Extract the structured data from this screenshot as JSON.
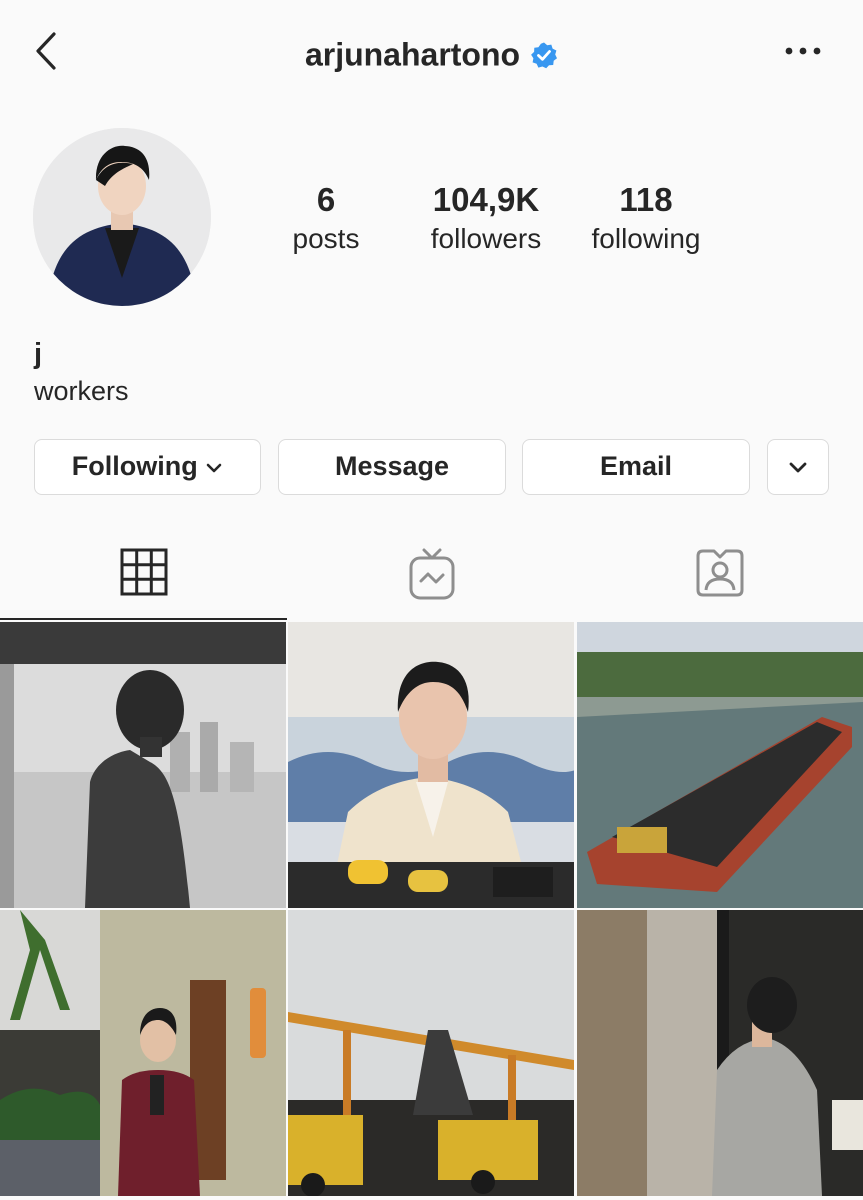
{
  "header": {
    "username": "arjunahartono",
    "verified": true,
    "back_icon": "chevron-left-icon",
    "more_icon": "more-horizontal-icon"
  },
  "profile": {
    "stats": [
      {
        "value": "6",
        "label": "posts"
      },
      {
        "value": "104,9K",
        "label": "followers"
      },
      {
        "value": "118",
        "label": "following"
      }
    ],
    "name": "j",
    "bio": "workers"
  },
  "actions": {
    "following_label": "Following",
    "message_label": "Message",
    "email_label": "Email"
  },
  "tabs": [
    {
      "icon": "grid-icon",
      "active": true
    },
    {
      "icon": "igtv-icon",
      "active": false
    },
    {
      "icon": "tagged-icon",
      "active": false
    }
  ],
  "colors": {
    "verified_blue": "#3897f0",
    "text": "#262626",
    "border": "#dbdbdb",
    "background": "#fafafa"
  }
}
